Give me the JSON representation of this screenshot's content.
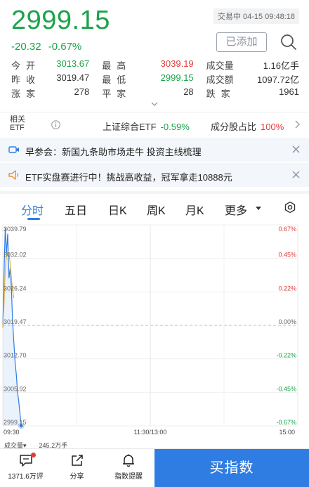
{
  "quote": {
    "price": "2999.15",
    "change": "-20.32",
    "change_pct": "-0.67%",
    "status": "交易中 04-15 09:48:18",
    "add_label": "已添加"
  },
  "stats": [
    [
      {
        "label": "今开",
        "value": "3013.67",
        "dir": "down"
      },
      {
        "label": "最高",
        "value": "3039.19",
        "dir": "up"
      },
      {
        "label": "成交量",
        "value": "1.16亿手",
        "dir": "neu"
      }
    ],
    [
      {
        "label": "昨收",
        "value": "3019.47",
        "dir": "neu"
      },
      {
        "label": "最低",
        "value": "2999.15",
        "dir": "down"
      },
      {
        "label": "成交额",
        "value": "1097.72亿",
        "dir": "neu"
      }
    ],
    [
      {
        "label": "涨家",
        "value": "278",
        "dir": "neu"
      },
      {
        "label": "平家",
        "value": "28",
        "dir": "neu"
      },
      {
        "label": "跌家",
        "value": "1961",
        "dir": "neu"
      }
    ]
  ],
  "etf": {
    "label_line1": "相关",
    "label_line2": "ETF",
    "index_name": "上证综合ETF",
    "index_change": "-0.59%",
    "component_label": "成分股占比",
    "component_value": "100%"
  },
  "banners": [
    {
      "icon": "video-icon",
      "text": "早参会：新国九条助市场走牛 投资主线梳理"
    },
    {
      "icon": "speaker-icon",
      "text": "ETF实盘赛进行中！挑战高收益，冠军拿走10888元"
    }
  ],
  "tabs": [
    "分时",
    "五日",
    "日K",
    "周K",
    "月K",
    "更多"
  ],
  "active_tab": "分时",
  "colors": {
    "up": "#e23b3b",
    "down": "#1aa34a",
    "accent": "#2f7ce3",
    "avg_line": "#e0b43a"
  },
  "chart_data": {
    "type": "line",
    "y_labels_left": [
      "3039.79",
      "3032.02",
      "3026.24",
      "3019.47",
      "3012.70",
      "3005.92",
      "2999.15"
    ],
    "y_labels_right": [
      "0.67%",
      "0.45%",
      "0.22%",
      "0.00%",
      "-0.22%",
      "-0.45%",
      "-0.67%"
    ],
    "x_labels": [
      "09:30",
      "11:30/13:00",
      "15:00"
    ],
    "ylim": [
      2999.15,
      3039.79
    ],
    "reference": 3019.47,
    "total_minutes": 240,
    "series": [
      {
        "key": "price",
        "values": [
          3019.0,
          3030.5,
          3039.19,
          3034.0,
          3038.0,
          3029.0,
          3031.0,
          3027.0,
          3020.0,
          3016.0,
          3012.0,
          3009.5,
          3006.0,
          3004.0,
          3001.5,
          2999.15
        ]
      },
      {
        "key": "avg",
        "values": [
          3019.0,
          3024.0,
          3031.0,
          3033.5,
          3034.5,
          3034.0,
          3032.0,
          3029.0,
          3026.5,
          3025.0
        ]
      }
    ]
  },
  "volume": {
    "label": "成交量",
    "value": "245.2万手"
  },
  "bottom_bar": {
    "comments": "1371.6万评",
    "share": "分享",
    "alert": "指数提醒",
    "buy": "买指数"
  }
}
